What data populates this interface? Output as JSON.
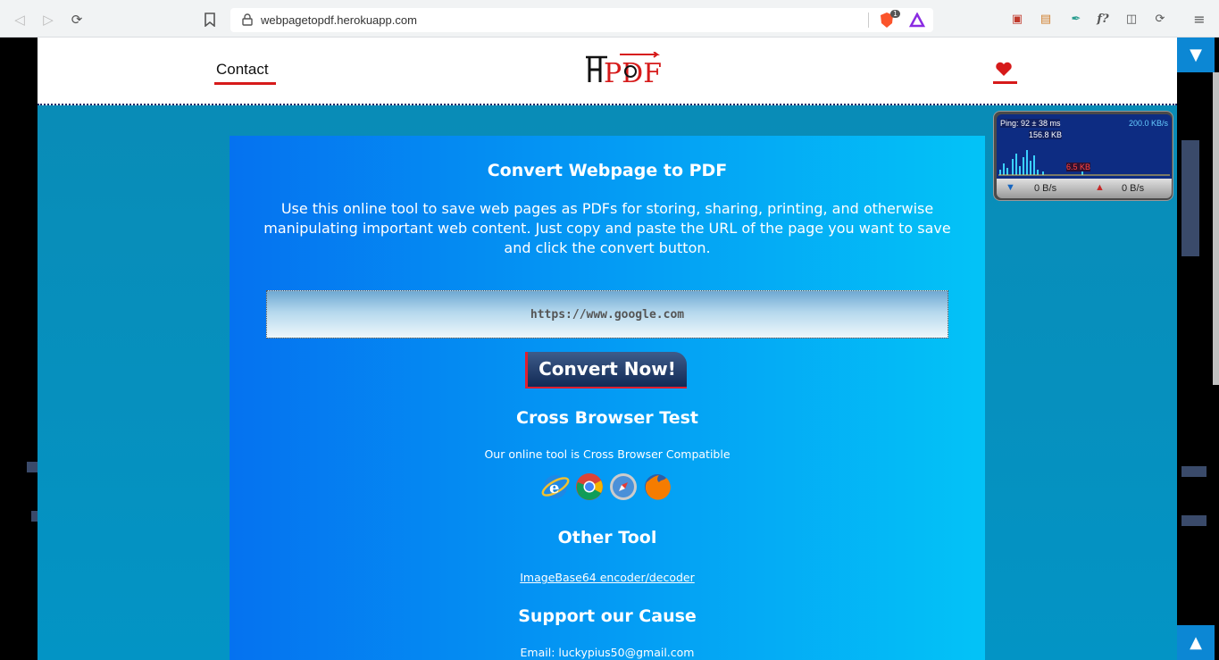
{
  "browser": {
    "url": "webpagetopdf.herokuapp.com",
    "brave_badge": "1"
  },
  "header": {
    "contact_label": "Contact"
  },
  "main": {
    "title": "Convert Webpage to PDF",
    "description": "Use this online tool to save web pages as PDFs for storing, sharing, printing, and otherwise manipulating important web content. Just copy and paste the URL of the page you want to save and click the convert button.",
    "url_input_value": "https://www.google.com",
    "convert_label": "Convert Now!",
    "cross_browser_title": "Cross Browser Test",
    "cross_browser_text": "Our online tool is Cross Browser Compatible",
    "other_tool_title": "Other Tool",
    "other_tool_link": "ImageBase64 encoder/decoder",
    "support_title": "Support our Cause",
    "email_text": "Email: luckypius50@gmail.com"
  },
  "ping_widget": {
    "ping": "Ping: 92 ± 38 ms",
    "max_rate": "200.0 KB/s",
    "peak": "156.8 KB",
    "current": "6.5 KB",
    "down": "0 B/s",
    "up": "0 B/s"
  },
  "colors": {
    "accent_red": "#d61a1a",
    "card_left": "#0572f0",
    "card_right": "#03c3f7",
    "scroll_button": "#0c87d4"
  }
}
